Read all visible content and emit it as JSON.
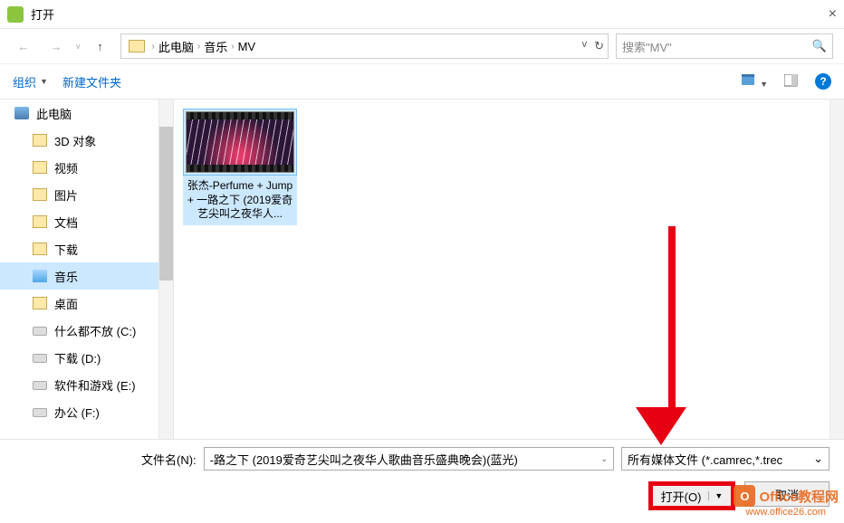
{
  "title": "打开",
  "close_char": "×",
  "nav": {
    "back": "←",
    "fwd": "→",
    "up": "↑"
  },
  "breadcrumb": {
    "items": [
      "此电脑",
      "音乐",
      "MV"
    ],
    "sep": "›",
    "refresh": "↻",
    "dd": "v"
  },
  "search": {
    "placeholder": "搜索\"MV\"",
    "icon": "🔍"
  },
  "toolbar": {
    "organize": "组织",
    "newfolder": "新建文件夹",
    "help": "?"
  },
  "sidebar": [
    {
      "label": "此电脑",
      "icon": "ico-pc",
      "child": false,
      "selected": false
    },
    {
      "label": "3D 对象",
      "icon": "ico-folder",
      "child": true,
      "selected": false
    },
    {
      "label": "视频",
      "icon": "ico-folder",
      "child": true,
      "selected": false
    },
    {
      "label": "图片",
      "icon": "ico-folder",
      "child": true,
      "selected": false
    },
    {
      "label": "文档",
      "icon": "ico-folder",
      "child": true,
      "selected": false
    },
    {
      "label": "下载",
      "icon": "ico-folder",
      "child": true,
      "selected": false
    },
    {
      "label": "音乐",
      "icon": "ico-music",
      "child": true,
      "selected": true
    },
    {
      "label": "桌面",
      "icon": "ico-folder",
      "child": true,
      "selected": false
    },
    {
      "label": "什么都不放 (C:)",
      "icon": "ico-drive",
      "child": true,
      "selected": false
    },
    {
      "label": "下载 (D:)",
      "icon": "ico-drive",
      "child": true,
      "selected": false
    },
    {
      "label": "软件和游戏 (E:)",
      "icon": "ico-drive",
      "child": true,
      "selected": false
    },
    {
      "label": "办公 (F:)",
      "icon": "ico-drive",
      "child": true,
      "selected": false
    }
  ],
  "file": {
    "name": "张杰-Perfume + Jump + 一路之下 (2019爱奇艺尖叫之夜华人..."
  },
  "footer": {
    "fn_label": "文件名(N):",
    "fn_value": "-路之下 (2019爱奇艺尖叫之夜华人歌曲音乐盛典晚会)(蓝光)",
    "filetype": "所有媒体文件 (*.camrec,*.trec",
    "open": "打开(O)",
    "cancel": "取消"
  },
  "watermark": {
    "brand": "Office教程网",
    "url": "www.office26.com",
    "icon": "O"
  }
}
